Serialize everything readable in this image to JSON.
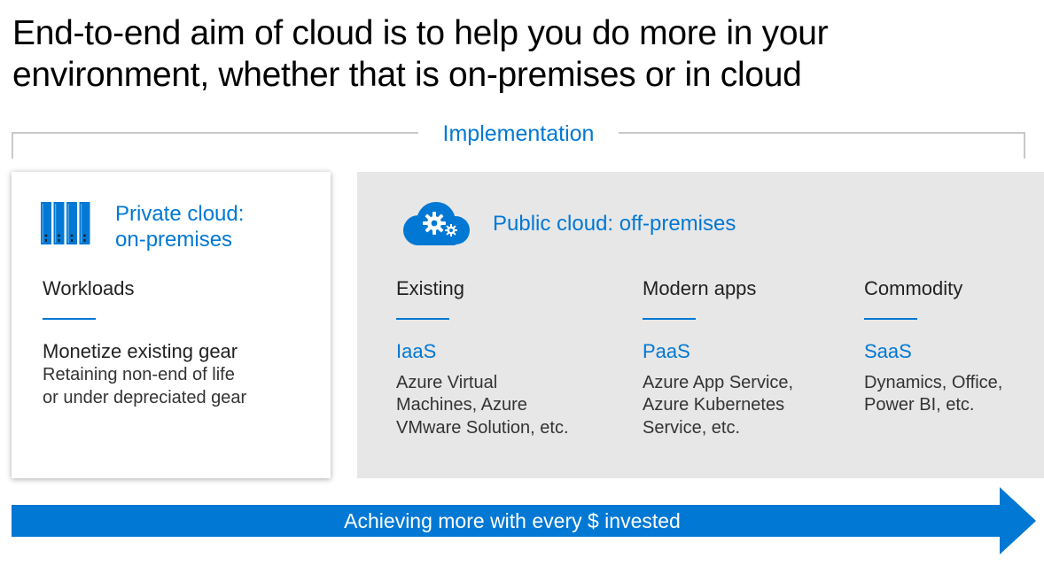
{
  "title": "End-to-end aim of cloud is to help you do more in your environment, whether that is on-premises or in cloud",
  "implementation_label": "Implementation",
  "private": {
    "heading_line1": "Private cloud:",
    "heading_line2": "on-premises",
    "column": {
      "title": "Workloads",
      "subtitle": "Monetize existing gear",
      "body_line1": "Retaining non-end of life",
      "body_line2": "or under depreciated gear"
    }
  },
  "public": {
    "heading": "Public cloud: off-premises",
    "columns": [
      {
        "title": "Existing",
        "subtitle": "IaaS",
        "body_line1": "Azure Virtual",
        "body_line2": "Machines, Azure",
        "body_line3": "VMware Solution, etc."
      },
      {
        "title": "Modern apps",
        "subtitle": "PaaS",
        "body_line1": "Azure App Service,",
        "body_line2": "Azure Kubernetes",
        "body_line3": "Service, etc."
      },
      {
        "title": "Commodity",
        "subtitle": "SaaS",
        "body_line1": "Dynamics, Office,",
        "body_line2": "Power BI, etc."
      }
    ]
  },
  "arrow_label": "Achieving more with every $ invested",
  "icons": {
    "private": "server-rack-icon",
    "public": "cloud-gears-icon"
  },
  "colors": {
    "accent": "#0078d4",
    "public_panel": "#e7e7e7",
    "bracket": "#c9c9c9"
  }
}
